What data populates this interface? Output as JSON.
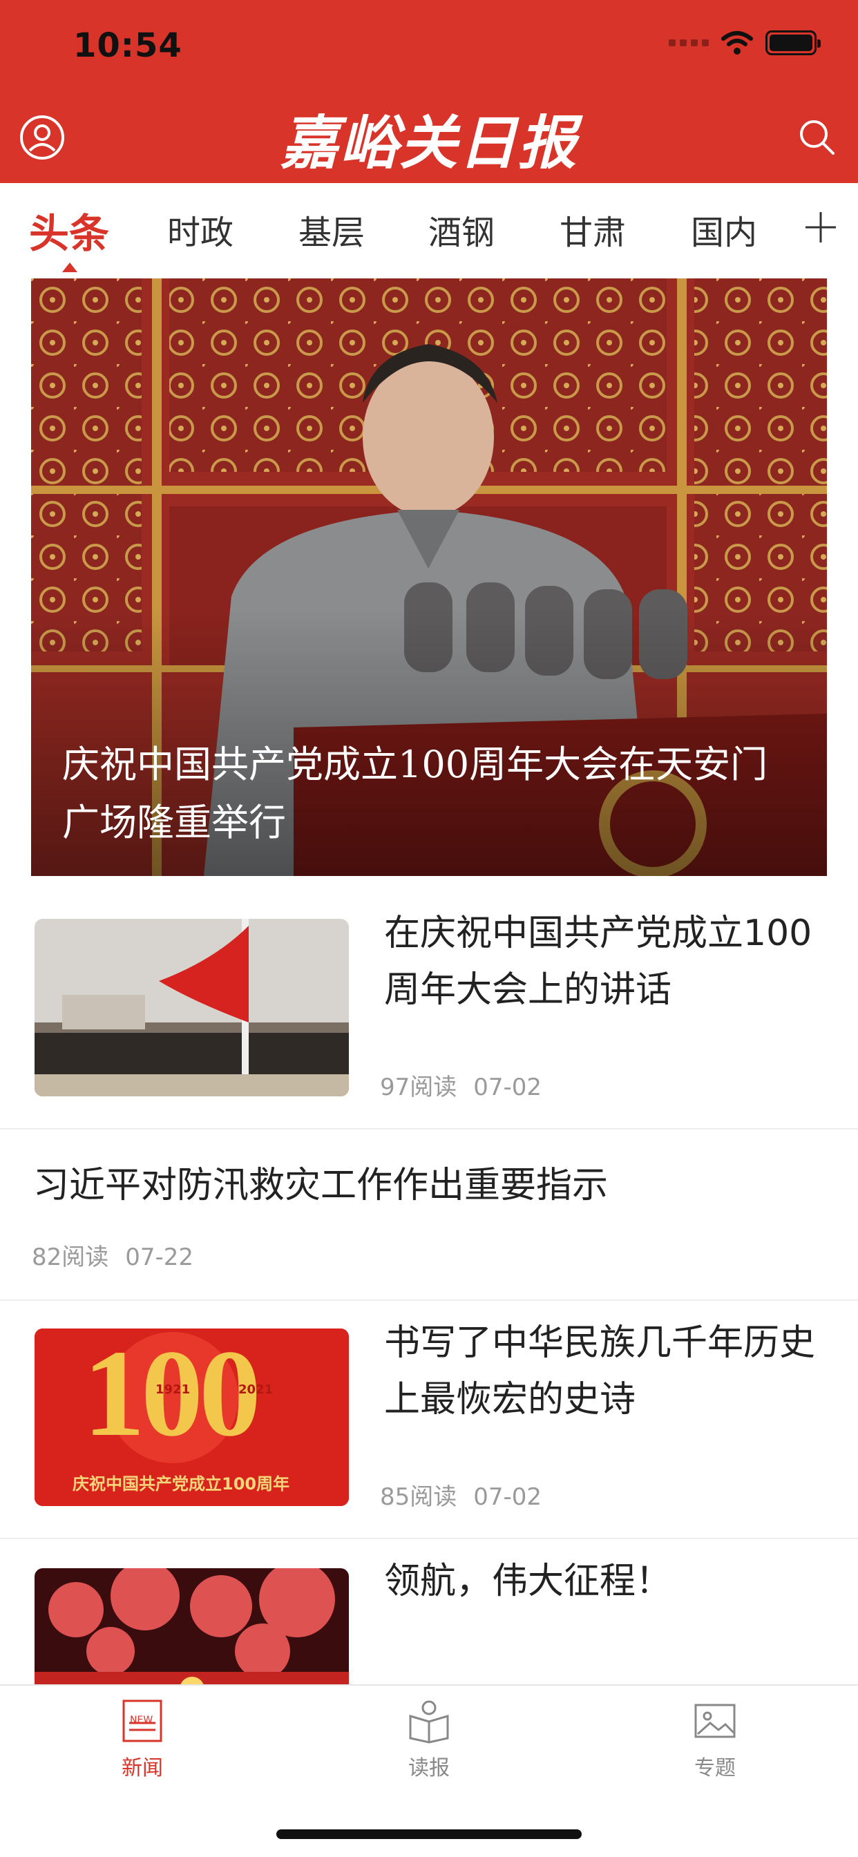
{
  "status": {
    "time": "10:54"
  },
  "header": {
    "logo_text": "嘉峪关日报"
  },
  "tabs": [
    {
      "label": "头条"
    },
    {
      "label": "时政"
    },
    {
      "label": "基层"
    },
    {
      "label": "酒钢"
    },
    {
      "label": "甘肃"
    },
    {
      "label": "国内"
    }
  ],
  "hero": {
    "title": "庆祝中国共产党成立100周年大会在天安门广场隆重举行"
  },
  "articles": [
    {
      "title": "在庆祝中国共产党成立100周年大会上的讲话",
      "reads": "97阅读",
      "date": "07-02"
    },
    {
      "title": "习近平对防汛救灾工作作出重要指示",
      "reads": "82阅读",
      "date": "07-22"
    },
    {
      "title": "书写了中华民族几千年历史上最恢宏的史诗",
      "reads": "85阅读",
      "date": "07-02",
      "thumb_banner": "庆祝中国共产党成立100周年",
      "thumb_badge_left": "1921",
      "thumb_badge_right": "2021",
      "thumb_big": "100"
    },
    {
      "title": "领航，伟大征程！"
    }
  ],
  "tabbar": [
    {
      "label": "新闻",
      "icon_badge": "NEW"
    },
    {
      "label": "读报"
    },
    {
      "label": "专题"
    }
  ],
  "colors": {
    "brand": "#d8342a",
    "muted": "#9a9a9a"
  },
  "icons": [
    "user-icon",
    "search-icon",
    "plus-icon",
    "news-icon",
    "read-paper-icon",
    "topic-image-icon"
  ]
}
